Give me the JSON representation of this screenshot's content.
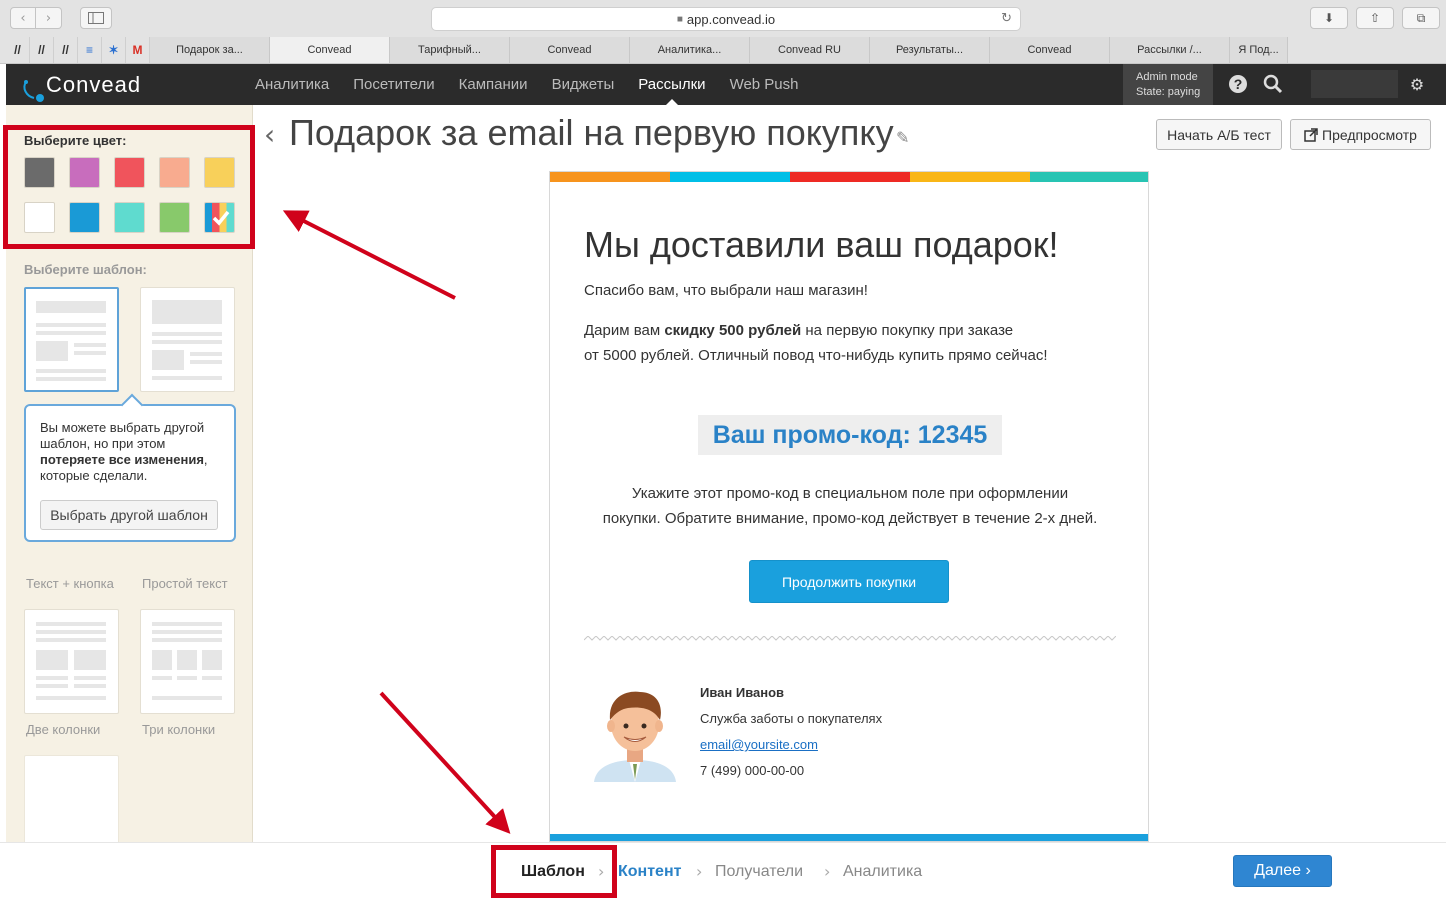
{
  "browser": {
    "url": "app.convead.io",
    "tabs": [
      "Подарок за...",
      "Convead",
      "Тарифный...",
      "Convead",
      "Аналитика...",
      "Convead RU",
      "Результаты...",
      "Convead",
      "Рассылки /...",
      "Я Под..."
    ]
  },
  "app": {
    "logo": "Convead",
    "menu": [
      "Аналитика",
      "Посетители",
      "Кампании",
      "Виджеты",
      "Рассылки",
      "Web Push"
    ],
    "active_menu": "Рассылки",
    "admin_mode": "Admin mode",
    "state": "State: paying"
  },
  "sidebar": {
    "color_title": "Выберите цвет:",
    "colors": [
      "#6b6b6b",
      "#c86dbd",
      "#f0545c",
      "#f8ab8f",
      "#f8d05a",
      "#ffffff",
      "#1a9ad6",
      "#5fdbcf",
      "#88c96b",
      "multicolor"
    ],
    "template_title": "Выберите шаблон:",
    "templates": [
      "Текст + кнопка",
      "Простой текст",
      "Две колонки",
      "Три колонки"
    ],
    "tooltip": {
      "text1": "Вы можете выбрать другой шаблон, но при этом",
      "text_bold": "потеряете все изменения",
      "text2": ", которые сделали.",
      "button": "Выбрать другой шаблон"
    }
  },
  "main": {
    "title": "Подарок за email на первую покупку",
    "ab_button": "Начать А/Б тест",
    "preview_button": "Предпросмотр"
  },
  "email": {
    "stripe_colors": [
      "#f7941d",
      "#00bfe7",
      "#ee2a24",
      "#f9b616",
      "#28c4b3"
    ],
    "heading": "Мы доставили ваш подарок!",
    "thanks": "Спасибо вам, что выбрали наш магазин!",
    "offer_pre": "Дарим вам ",
    "offer_bold": "скидку 500 рублей",
    "offer_post": " на первую покупку при заказе",
    "offer_line2": "от 5000 рублей. Отличный повод что-нибудь купить прямо сейчас!",
    "promo": "Ваш промо-код: 12345",
    "instr1": "Укажите этот промо-код в специальном поле при оформлении",
    "instr2": "покупки. Обратите внимание, промо-код действует в течение 2-х дней.",
    "cta": "Продолжить покупки",
    "sig_name": "Иван Иванов",
    "sig_role": "Служба заботы о покупателях",
    "sig_email": "email@yoursite.com",
    "sig_phone": "7 (499) 000-00-00"
  },
  "footer": {
    "steps": [
      "Шаблон",
      "Контент",
      "Получатели",
      "Аналитика"
    ],
    "current_step": "Шаблон",
    "next": "Далее"
  }
}
